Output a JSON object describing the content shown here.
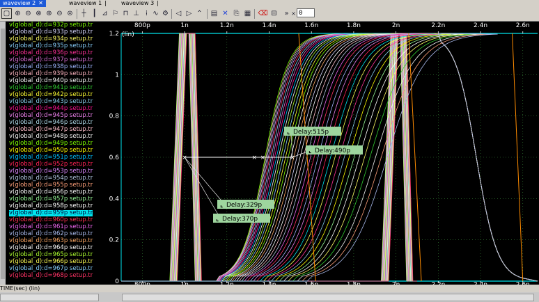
{
  "tabs": [
    {
      "label": "waveview 2",
      "active": true
    },
    {
      "label": "waveview 1",
      "active": false
    },
    {
      "label": "waveview 3",
      "active": false
    }
  ],
  "tab_close_glyph": "✕",
  "toolbar": {
    "zoom_value": "0",
    "icons": [
      "zoom-fit-icon",
      "zoom-in-icon",
      "zoom-out-icon",
      "zoom-area-icon",
      "zoom-x-icon",
      "zoom-y-icon",
      "crosshair-icon",
      "vertical-cursor-icon",
      "marker-icon",
      "flag-icon",
      "edge-icon",
      "grid-icon",
      "wave-icon",
      "measure-icon",
      "left-arrow-icon",
      "right-arrow-icon",
      "rise-icon",
      "panel-icon",
      "delete-x-icon",
      "copy-icon",
      "paste-icon",
      "eraser-icon",
      "table-icon",
      "chevron-icon"
    ]
  },
  "signals": [
    {
      "name": "v(global_d):d=932p setup.tr",
      "color": "#7cfc00"
    },
    {
      "name": "v(global_d):d=933p setup.tr",
      "color": "#d8d8ff"
    },
    {
      "name": "v(global_d):d=934p setup.tr",
      "color": "#ffff66"
    },
    {
      "name": "v(global_d):d=935p setup.tr",
      "color": "#87cefa"
    },
    {
      "name": "v(global_d):d=936p setup.tr",
      "color": "#ff3399"
    },
    {
      "name": "v(global_d):d=937p setup.tr",
      "color": "#da70d6"
    },
    {
      "name": "v(global_d):d=938p setup.tr",
      "color": "#9fb6ff"
    },
    {
      "name": "v(global_d):d=939p setup.tr",
      "color": "#ffb6c1"
    },
    {
      "name": "v(global_d):d=940p setup.tr",
      "color": "#ffffff"
    },
    {
      "name": "v(global_d):d=941p setup.tr",
      "color": "#32cd32"
    },
    {
      "name": "v(global_d):d=942p setup.tr",
      "color": "#ffff33"
    },
    {
      "name": "v(global_d):d=943p setup.tr",
      "color": "#87ceeb"
    },
    {
      "name": "v(global_d):d=944p setup.tr",
      "color": "#ff1493"
    },
    {
      "name": "v(global_d):d=945p setup.tr",
      "color": "#ee82ee"
    },
    {
      "name": "v(global_d):d=946p setup.tr",
      "color": "#add8e6"
    },
    {
      "name": "v(global_d):d=947p setup.tr",
      "color": "#ffc0cb"
    },
    {
      "name": "v(global_d):d=948p setup.tr",
      "color": "#f5f5f5"
    },
    {
      "name": "v(global_d):d=949p setup.tr",
      "color": "#7fff00"
    },
    {
      "name": "v(global_d):d=950p setup.tr",
      "color": "#ffff00"
    },
    {
      "name": "v(global_d):d=951p setup.tr",
      "color": "#00bfff"
    },
    {
      "name": "v(global_d):d=952p setup.tr",
      "color": "#ff2255"
    },
    {
      "name": "v(global_d):d=953p setup.tr",
      "color": "#dd88ff"
    },
    {
      "name": "v(global_d):d=954p setup.tr",
      "color": "#b0c4de"
    },
    {
      "name": "v(global_d):d=955p setup.tr",
      "color": "#ffa07a"
    },
    {
      "name": "v(global_d):d=956p setup.tr",
      "color": "#ffffff"
    },
    {
      "name": "v(global_d):d=957p setup.tr",
      "color": "#98fb98"
    },
    {
      "name": "v(global_d):d=958p setup.tr",
      "color": "#ffffff"
    },
    {
      "name": "v(global_d):d=959p setup.tr",
      "color": "#003",
      "selected": true
    },
    {
      "name": "v(global_d):d=960p setup.tr",
      "color": "#ff3355"
    },
    {
      "name": "v(global_d):d=961p setup.tr",
      "color": "#ee66ee"
    },
    {
      "name": "v(global_d):d=962p setup.tr",
      "color": "#aabbee"
    },
    {
      "name": "v(global_d):d=963p setup.tr",
      "color": "#ffaa66"
    },
    {
      "name": "v(global_d):d=964p setup.tr",
      "color": "#ffffff"
    },
    {
      "name": "v(global_d):d=965p setup.tr",
      "color": "#adff2f"
    },
    {
      "name": "v(global_d):d=966p setup.tr",
      "color": "#ffff55"
    },
    {
      "name": "v(global_d):d=967p setup.tr",
      "color": "#87cefa"
    },
    {
      "name": "v(global_d):d=968p setup.tr",
      "color": "#ff3366"
    }
  ],
  "chart_data": {
    "type": "line",
    "y_unit_label": "(lin)",
    "xlabel": "TIME(sec) (lin)",
    "x_ticks": [
      "800p",
      "1n",
      "1.2n",
      "1.4n",
      "1.6n",
      "1.8n",
      "2n",
      "2.2n",
      "2.4n",
      "2.6n"
    ],
    "y_ticks": [
      "1.2",
      "1",
      "0.8",
      "0.6",
      "0.4",
      "0.2",
      "0"
    ],
    "xlim": [
      0.7,
      2.67
    ],
    "ylim": [
      0,
      1.2
    ],
    "grid": true,
    "measurements": [
      {
        "label": "Delay:515p",
        "marker_x": [
          1.0,
          1.51
        ],
        "marker_y": 0.6
      },
      {
        "label": "Delay:490p",
        "marker_x": [
          1.0,
          1.51
        ],
        "marker_y": 0.6
      },
      {
        "label": "Delay:329p",
        "marker_x": [
          1.0,
          1.33
        ],
        "marker_y": 0.6
      },
      {
        "label": "Delay:370p",
        "marker_x": [
          1.0,
          1.37
        ],
        "marker_y": 0.6
      }
    ],
    "series_summary": {
      "count": 37,
      "clock_pulse_1": [
        0.93,
        1.02
      ],
      "clock_pulse_2": [
        1.93,
        2.02
      ],
      "output_rise_start": [
        1.15,
        1.58
      ],
      "output_high_until": 2.2,
      "output_fall_end": 2.6
    }
  },
  "colors": {
    "plot_bg": "#000000",
    "grid": "#3a8a3a",
    "axis": "#00e5ee",
    "selected": "#00e5ee"
  }
}
